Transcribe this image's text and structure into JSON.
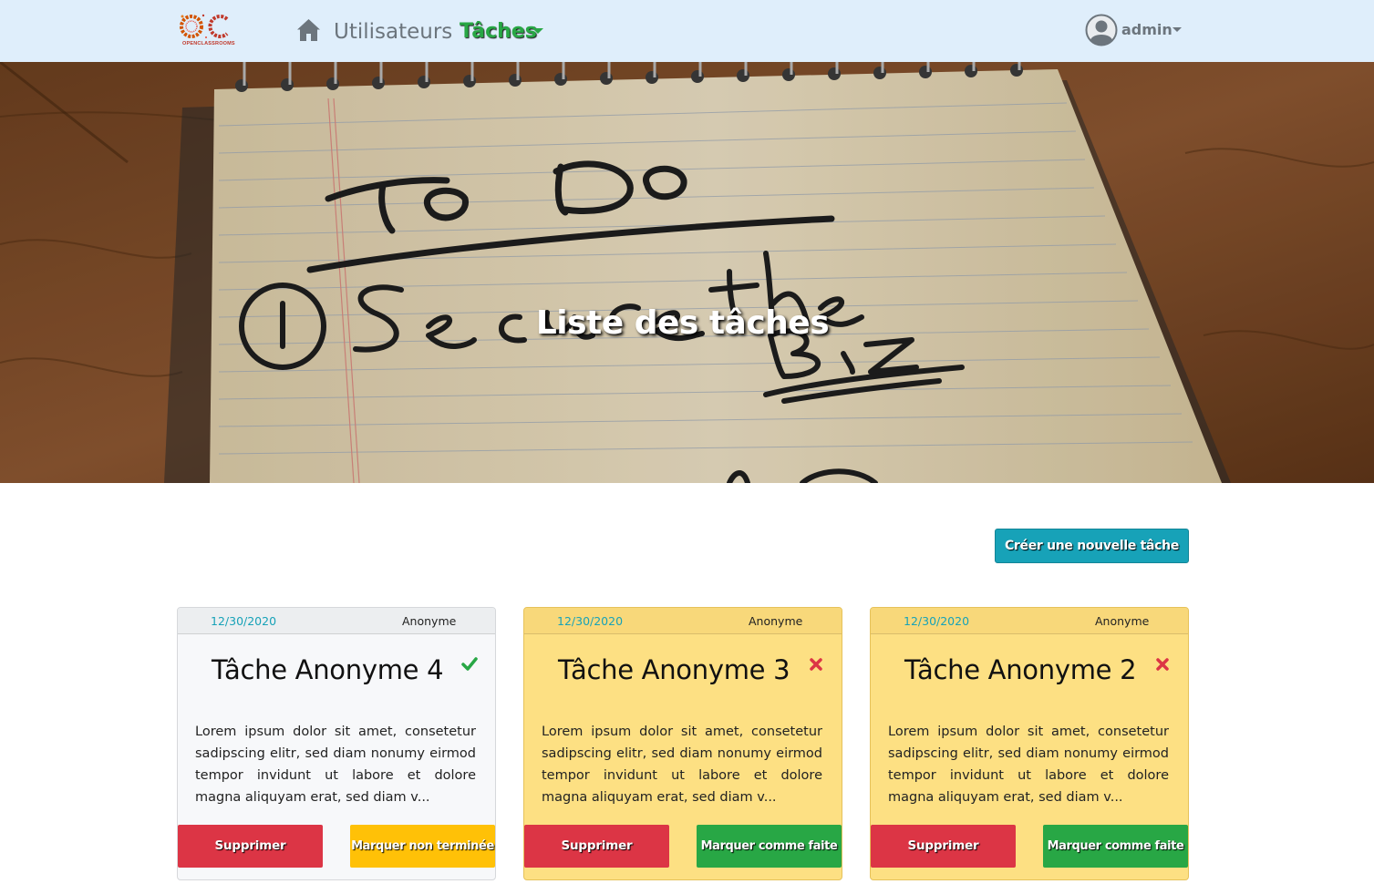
{
  "navbar": {
    "logo_text": "OPENCLASSROOMS",
    "users_label": "Utilisateurs",
    "tasks_label": "Tâches",
    "user_label": "admin"
  },
  "hero": {
    "title": "Liste des tâches"
  },
  "actions": {
    "create_label": "Créer une nouvelle tâche"
  },
  "colors": {
    "navbar_bg": "#dfeefb",
    "accent_info": "#17a2b8",
    "success": "#28a745",
    "danger": "#dc3545",
    "warning": "#ffc107",
    "card_todo_bg": "#fde083"
  },
  "tasks": [
    {
      "date": "12/30/2020",
      "author": "Anonyme",
      "title": "Tâche Anonyme 4",
      "status_icon": "check-icon",
      "done": true,
      "excerpt": "Lorem ipsum dolor sit amet, consetetur sadipscing elitr, sed diam nonumy eirmod tempor invidunt ut labore et dolore magna aliquyam erat, sed diam v...",
      "delete_label": "Supprimer",
      "toggle_label": "Marquer non terminée"
    },
    {
      "date": "12/30/2020",
      "author": "Anonyme",
      "title": "Tâche Anonyme 3",
      "status_icon": "cross-icon",
      "done": false,
      "excerpt": "Lorem ipsum dolor sit amet, consetetur sadipscing elitr, sed diam nonumy eirmod tempor invidunt ut labore et dolore magna aliquyam erat, sed diam v...",
      "delete_label": "Supprimer",
      "toggle_label": "Marquer comme faite"
    },
    {
      "date": "12/30/2020",
      "author": "Anonyme",
      "title": "Tâche Anonyme 2",
      "status_icon": "cross-icon",
      "done": false,
      "excerpt": "Lorem ipsum dolor sit amet, consetetur sadipscing elitr, sed diam nonumy eirmod tempor invidunt ut labore et dolore magna aliquyam erat, sed diam v...",
      "delete_label": "Supprimer",
      "toggle_label": "Marquer comme faite"
    }
  ]
}
